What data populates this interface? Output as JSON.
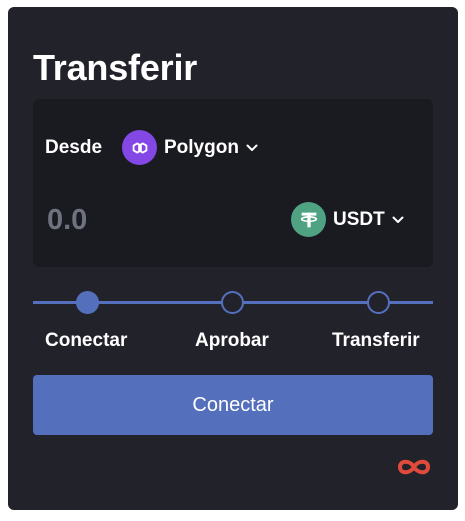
{
  "title": "Transferir",
  "source": {
    "label": "Desde",
    "network": "Polygon",
    "network_icon": "polygon-logo-icon"
  },
  "amount": {
    "value": "",
    "placeholder": "0.0"
  },
  "token": {
    "symbol": "USDT",
    "icon": "tether-logo-icon"
  },
  "steps": [
    {
      "label": "Conectar",
      "active": true
    },
    {
      "label": "Aprobar",
      "active": false
    },
    {
      "label": "Transferir",
      "active": false
    }
  ],
  "action": {
    "label": "Conectar"
  },
  "colors": {
    "background": "#22222b",
    "panel": "#1a1a21",
    "accent": "#5470bd",
    "polygon": "#8247e5",
    "tether": "#4fa382",
    "brand": "#e04a3a"
  }
}
